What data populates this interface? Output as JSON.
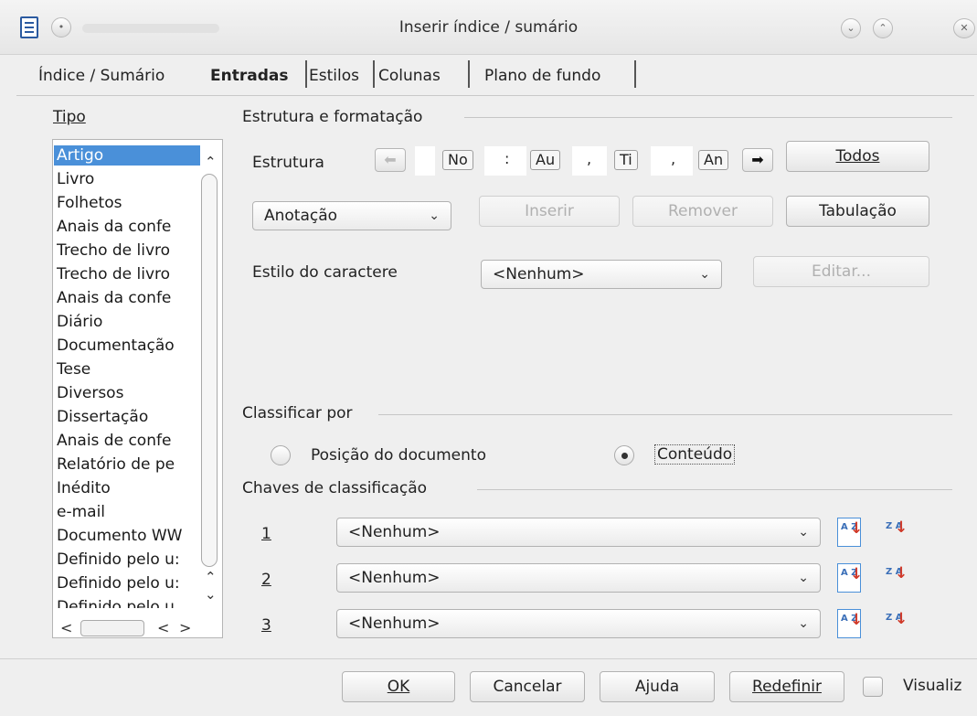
{
  "window": {
    "title": "Inserir índice / sumário"
  },
  "tabs": [
    "Índice / Sumário",
    "Entradas",
    "Estilos",
    "Colunas",
    "Plano de fundo"
  ],
  "tipo": {
    "label": "Tipo",
    "items": [
      "Artigo",
      "Livro",
      "Folhetos",
      "Anais da confe",
      "Trecho de livro",
      "Trecho de livro",
      "Anais da confe",
      "Diário",
      "Documentação",
      "Tese",
      "Diversos",
      "Dissertação",
      "Anais de confe",
      "Relatório de pe",
      "Inédito",
      "e-mail",
      "Documento WW",
      "Definido pelo u:",
      "Definido pelo u:",
      "Definido pelo u"
    ]
  },
  "estrutura": {
    "section_title": "Estrutura e formatação",
    "label": "Estrutura",
    "tokens": [
      "No",
      "Au",
      "Ti",
      "An"
    ],
    "separators": [
      ":",
      ",",
      ","
    ],
    "todos_button": "Todos",
    "anotacao_combo": "Anotação",
    "inserir_button": "Inserir",
    "remover_button": "Remover",
    "tabulacao_button": "Tabulação",
    "char_style_label": "Estilo do caractere",
    "char_style_value": "<Nenhum>",
    "editar_button": "Editar..."
  },
  "classificar": {
    "section_title": "Classificar por",
    "option_position": "Posição do documento",
    "option_content": "Conteúdo",
    "selected": "Conteúdo"
  },
  "chaves": {
    "section_title": "Chaves de classificação",
    "keys": [
      {
        "num": "1",
        "value": "<Nenhum>"
      },
      {
        "num": "2",
        "value": "<Nenhum>"
      },
      {
        "num": "3",
        "value": "<Nenhum>"
      }
    ],
    "asc_glyph": "A Z",
    "desc_glyph": "Z A"
  },
  "footer": {
    "ok": "OK",
    "cancel": "Cancelar",
    "help": "Ajuda",
    "reset": "Redefinir",
    "preview": "Visualiz"
  },
  "colors": {
    "selection": "#4a90d9",
    "sort_accent": "#3b6fb8",
    "sort_arrow": "#d03a2a"
  }
}
